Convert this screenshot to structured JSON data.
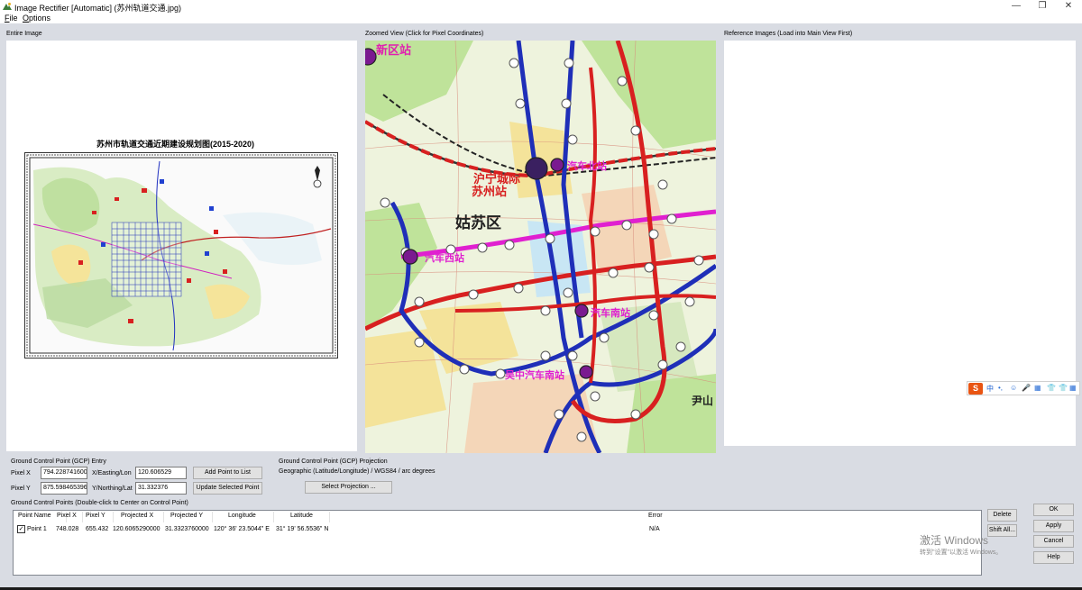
{
  "window": {
    "title": "Image Rectifier [Automatic] (苏州轨道交通.jpg)",
    "minimize_glyph": "—",
    "maximize_glyph": "❐",
    "close_glyph": "✕"
  },
  "menu": {
    "file": "File",
    "options": "Options"
  },
  "panels": {
    "entire_image": "Entire Image",
    "zoomed_view": "Zoomed View (Click for Pixel Coordinates)",
    "reference_images": "Reference Images (Load into Main View First)"
  },
  "entire_map": {
    "title": "苏州市轨道交通近期建设规划图(2015-2020)"
  },
  "zoom_map": {
    "labels": {
      "xinqu": "新区站",
      "huning": "沪宁城际",
      "suzhou": "苏州站",
      "bus_north": "汽车北站",
      "gusu": "姑苏区",
      "bus_west": "汽车西站",
      "bus_south": "汽车南站",
      "wuzhong": "吴中汽车南站",
      "yin": "尹山"
    }
  },
  "gcp_entry": {
    "section": "Ground Control Point (GCP) Entry",
    "pixel_x_label": "Pixel X",
    "pixel_x_value": "794.228741600(",
    "pixel_y_label": "Pixel Y",
    "pixel_y_value": "875.598465396(",
    "easting_label": "X/Easting/Lon",
    "easting_value": "120.606529",
    "northing_label": "Y/Northing/Lat",
    "northing_value": "31.332376",
    "add_button": "Add Point to List",
    "update_button": "Update Selected Point"
  },
  "gcp_projection": {
    "section": "Ground Control Point (GCP) Projection",
    "value": "Geographic (Latitude/Longitude) / WGS84 / arc degrees",
    "select_button": "Select Projection ..."
  },
  "gcp_list": {
    "section": "Ground Control Points (Double-click to Center on Control Point)",
    "columns": [
      "Point Name",
      "Pixel X",
      "Pixel Y",
      "Projected X",
      "Projected Y",
      "Longitude",
      "Latitude",
      "Error"
    ],
    "rows": [
      {
        "checked": true,
        "name": "Point 1",
        "pixel_x": "748.028",
        "pixel_y": "655.432",
        "proj_x": "120.6065290000",
        "proj_y": "31.3323760000",
        "lon": "120° 36' 23.5044\" E",
        "lat": "31° 19' 56.5536\" N",
        "error": "N/A"
      }
    ]
  },
  "side_buttons": {
    "delete": "Delete",
    "shift_all": "Shift All..."
  },
  "dialog_buttons": {
    "ok": "OK",
    "apply": "Apply",
    "cancel": "Cancel",
    "help": "Help"
  },
  "watermark": {
    "line1": "激活 Windows",
    "line2": "转到\"设置\"以激活 Windows。"
  },
  "ime": {
    "logo": "S",
    "items": [
      "中",
      "•,",
      "☺",
      "🎤",
      "▦",
      "👕",
      "👕",
      "▦"
    ]
  },
  "colors": {
    "client_bg": "#d9dce3",
    "metro_red": "#e02020",
    "metro_blue": "#1f2fb8",
    "metro_magenta": "#e020d0"
  }
}
